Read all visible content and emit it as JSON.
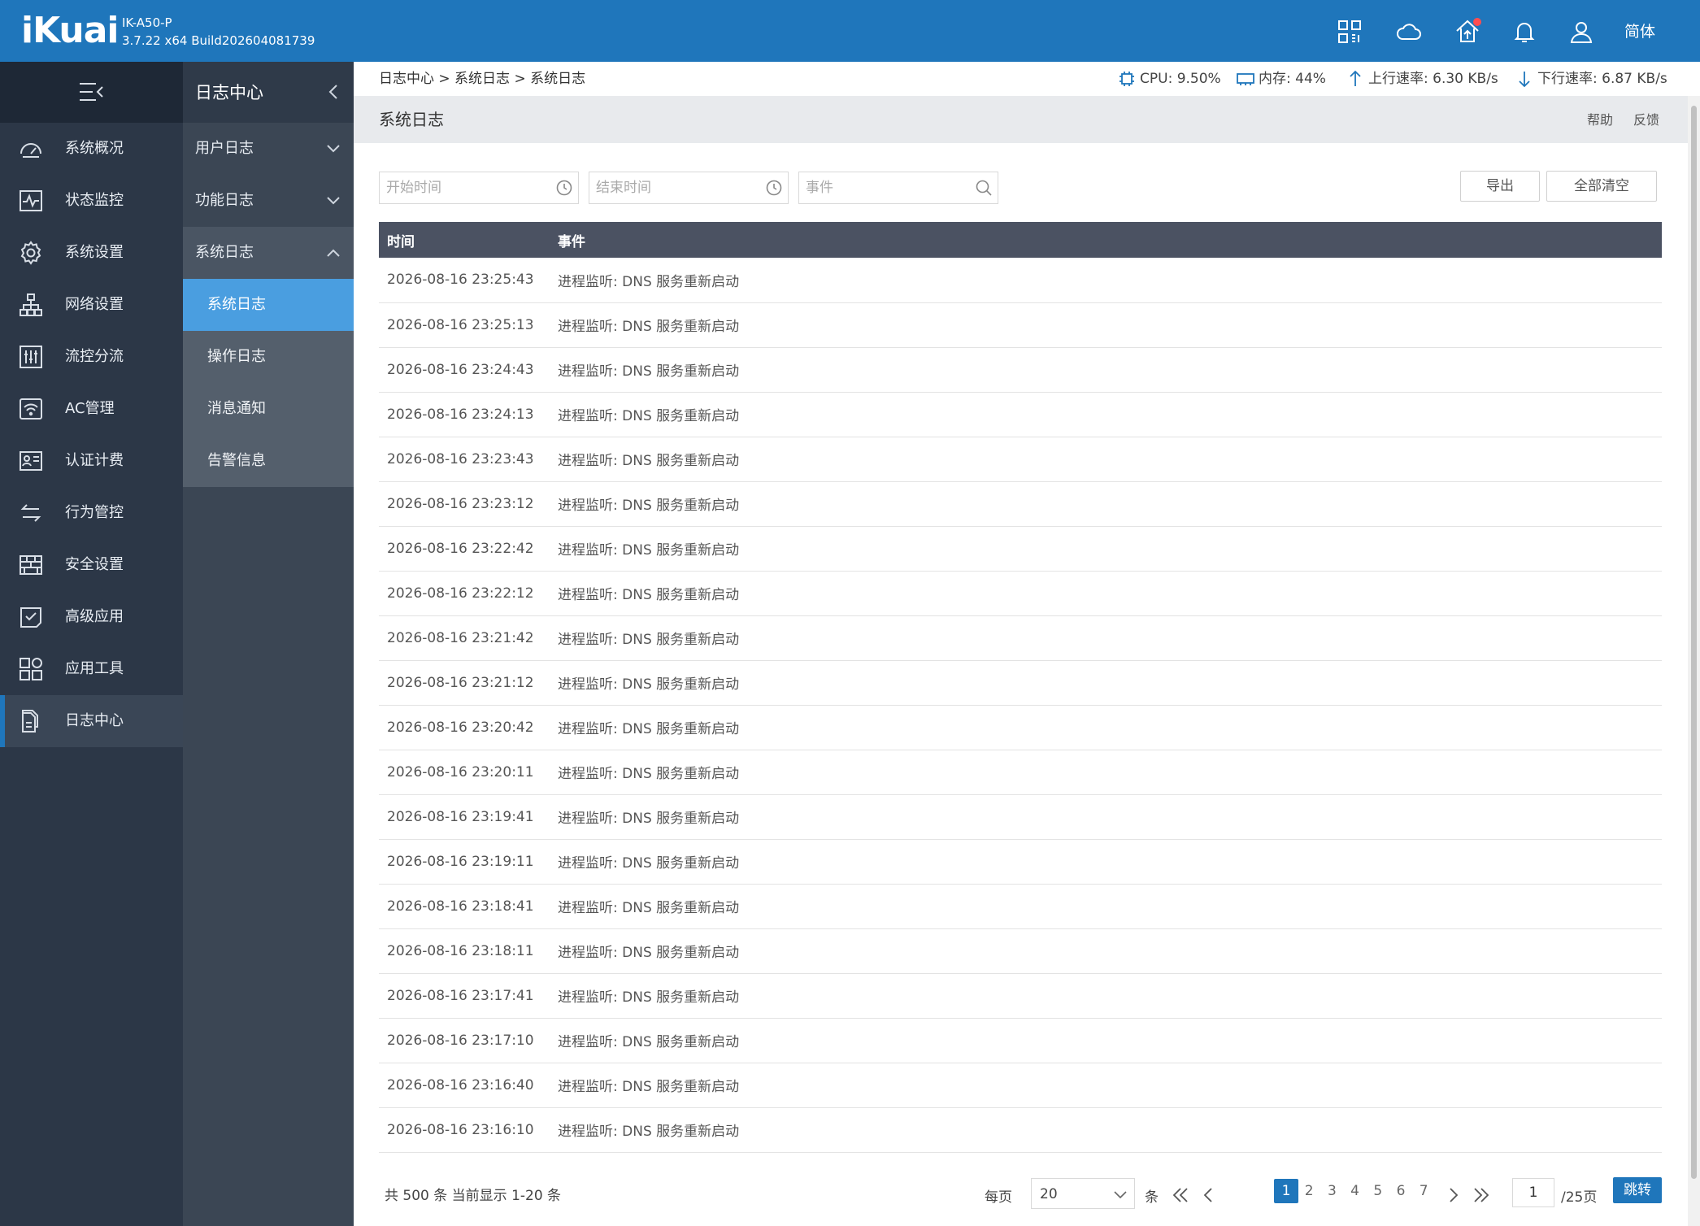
{
  "header": {
    "logo": "iKuai",
    "model": "IK-A50-P",
    "build": "3.7.22 x64 Build202604081739",
    "language": "简体",
    "icons": [
      "apps-grid-icon",
      "cloud-icon",
      "home-upgrade-icon",
      "bell-icon",
      "user-icon"
    ]
  },
  "sidebar": {
    "items": [
      {
        "label": "系统概况",
        "icon": "dashboard-icon"
      },
      {
        "label": "状态监控",
        "icon": "monitor-pulse-icon"
      },
      {
        "label": "系统设置",
        "icon": "gear-icon"
      },
      {
        "label": "网络设置",
        "icon": "network-tree-icon"
      },
      {
        "label": "流控分流",
        "icon": "sliders-icon"
      },
      {
        "label": "AC管理",
        "icon": "wifi-ac-icon"
      },
      {
        "label": "认证计费",
        "icon": "id-card-icon"
      },
      {
        "label": "行为管控",
        "icon": "arrows-swap-icon"
      },
      {
        "label": "安全设置",
        "icon": "firewall-icon"
      },
      {
        "label": "高级应用",
        "icon": "checklist-icon"
      },
      {
        "label": "应用工具",
        "icon": "apps-icon"
      },
      {
        "label": "日志中心",
        "icon": "documents-icon"
      }
    ]
  },
  "subnav": {
    "title": "日志中心",
    "groups": [
      {
        "label": "用户日志"
      },
      {
        "label": "功能日志"
      },
      {
        "label": "系统日志"
      }
    ],
    "children": [
      {
        "label": "系统日志"
      },
      {
        "label": "操作日志"
      },
      {
        "label": "消息通知"
      },
      {
        "label": "告警信息"
      }
    ]
  },
  "breadcrumb": "日志中心 > 系统日志 > 系统日志",
  "stats": {
    "cpu": "CPU: 9.50%",
    "memory": "内存: 44%",
    "upload": "上行速率: 6.30 KB/s",
    "download": "下行速率: 6.87 KB/s"
  },
  "page": {
    "title": "系统日志",
    "help": "帮助",
    "feedback": "反馈"
  },
  "filters": {
    "start_placeholder": "开始时间",
    "end_placeholder": "结束时间",
    "event_placeholder": "事件",
    "export": "导出",
    "clear_all": "全部清空"
  },
  "table": {
    "columns": [
      "时间",
      "事件"
    ],
    "rows": [
      [
        "2026-08-16 23:25:43",
        "进程监听: DNS 服务重新启动"
      ],
      [
        "2026-08-16 23:25:13",
        "进程监听: DNS 服务重新启动"
      ],
      [
        "2026-08-16 23:24:43",
        "进程监听: DNS 服务重新启动"
      ],
      [
        "2026-08-16 23:24:13",
        "进程监听: DNS 服务重新启动"
      ],
      [
        "2026-08-16 23:23:43",
        "进程监听: DNS 服务重新启动"
      ],
      [
        "2026-08-16 23:23:12",
        "进程监听: DNS 服务重新启动"
      ],
      [
        "2026-08-16 23:22:42",
        "进程监听: DNS 服务重新启动"
      ],
      [
        "2026-08-16 23:22:12",
        "进程监听: DNS 服务重新启动"
      ],
      [
        "2026-08-16 23:21:42",
        "进程监听: DNS 服务重新启动"
      ],
      [
        "2026-08-16 23:21:12",
        "进程监听: DNS 服务重新启动"
      ],
      [
        "2026-08-16 23:20:42",
        "进程监听: DNS 服务重新启动"
      ],
      [
        "2026-08-16 23:20:11",
        "进程监听: DNS 服务重新启动"
      ],
      [
        "2026-08-16 23:19:41",
        "进程监听: DNS 服务重新启动"
      ],
      [
        "2026-08-16 23:19:11",
        "进程监听: DNS 服务重新启动"
      ],
      [
        "2026-08-16 23:18:41",
        "进程监听: DNS 服务重新启动"
      ],
      [
        "2026-08-16 23:18:11",
        "进程监听: DNS 服务重新启动"
      ],
      [
        "2026-08-16 23:17:41",
        "进程监听: DNS 服务重新启动"
      ],
      [
        "2026-08-16 23:17:10",
        "进程监听: DNS 服务重新启动"
      ],
      [
        "2026-08-16 23:16:40",
        "进程监听: DNS 服务重新启动"
      ],
      [
        "2026-08-16 23:16:10",
        "进程监听: DNS 服务重新启动"
      ]
    ]
  },
  "pagination": {
    "summary": "共 500 条 当前显示 1-20 条",
    "per_page_label": "每页",
    "per_page_value": "20",
    "per_page_unit": "条",
    "pages": [
      "1",
      "2",
      "3",
      "4",
      "5",
      "6",
      "7"
    ],
    "current_page": "1",
    "total_pages": "/25页",
    "jump": "跳转"
  },
  "colors": {
    "header_blue": "#1f76bb",
    "sidebar_dark": "#2c3747",
    "active_blue": "#4a9ee0",
    "table_header": "#4b5262",
    "notification_dot": "#ff4d4f"
  }
}
